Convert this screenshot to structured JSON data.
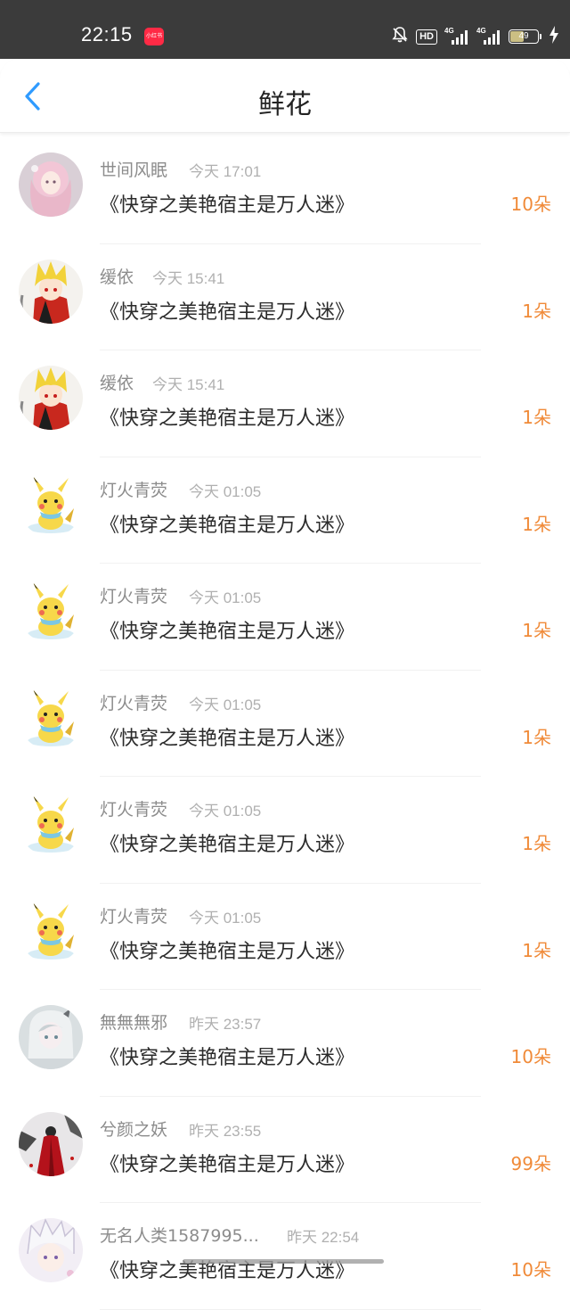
{
  "status_bar": {
    "time": "22:15",
    "app_badge": "小红书",
    "hd": "HD",
    "sim1": "4G",
    "sim2": "4G",
    "battery": "49"
  },
  "header": {
    "title": "鲜花"
  },
  "colors": {
    "accent_blue": "#2f9bff",
    "count_orange": "#f08a38",
    "username_gray": "#8c8c8c"
  },
  "records": [
    {
      "avatar": "pink-hair-girl",
      "user": "世间风眠",
      "time": "今天 17:01",
      "book": "《快穿之美艳宿主是万人迷》",
      "count": "10朵"
    },
    {
      "avatar": "blonde-anime-boy",
      "user": "缓依",
      "time": "今天 15:41",
      "book": "《快穿之美艳宿主是万人迷》",
      "count": "1朵"
    },
    {
      "avatar": "blonde-anime-boy",
      "user": "缓依",
      "time": "今天 15:41",
      "book": "《快穿之美艳宿主是万人迷》",
      "count": "1朵"
    },
    {
      "avatar": "pikachu",
      "user": "灯火青荧",
      "time": "今天 01:05",
      "book": "《快穿之美艳宿主是万人迷》",
      "count": "1朵"
    },
    {
      "avatar": "pikachu",
      "user": "灯火青荧",
      "time": "今天 01:05",
      "book": "《快穿之美艳宿主是万人迷》",
      "count": "1朵"
    },
    {
      "avatar": "pikachu",
      "user": "灯火青荧",
      "time": "今天 01:05",
      "book": "《快穿之美艳宿主是万人迷》",
      "count": "1朵"
    },
    {
      "avatar": "pikachu",
      "user": "灯火青荧",
      "time": "今天 01:05",
      "book": "《快穿之美艳宿主是万人迷》",
      "count": "1朵"
    },
    {
      "avatar": "pikachu",
      "user": "灯火青荧",
      "time": "今天 01:05",
      "book": "《快穿之美艳宿主是万人迷》",
      "count": "1朵"
    },
    {
      "avatar": "silver-hair-girl",
      "user": "無無無邪",
      "time": "昨天 23:57",
      "book": "《快穿之美艳宿主是万人迷》",
      "count": "10朵"
    },
    {
      "avatar": "red-robe-figure",
      "user": "兮颜之妖",
      "time": "昨天 23:55",
      "book": "《快穿之美艳宿主是万人迷》",
      "count": "99朵"
    },
    {
      "avatar": "white-hair-boy",
      "user": "无名人类1587995...",
      "time": "昨天 22:54",
      "book": "《快穿之美艳宿主是万人迷》",
      "count": "10朵"
    }
  ]
}
